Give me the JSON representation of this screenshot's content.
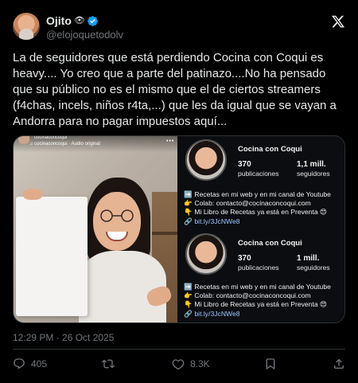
{
  "author": {
    "name": "Ojito",
    "name_emoji": "👁",
    "handle": "@elojoquetodolv",
    "verified": true
  },
  "tweet": {
    "text": "La de seguidores que está perdiendo Cocina con Coqui es heavy.... Yo creo que a parte del patinazo....No ha pensado que su público no es el mismo que el de ciertos streamers (f4chas, incels, niños r4ta,...) que les da igual que se vayan a Andorra para no pagar impuestos aquí...",
    "timestamp": "12:29 PM · 26 Oct 2025"
  },
  "media": {
    "ig_overlay": {
      "handle": "cocinaconcoqui",
      "audio": "♫ cocinaconcoqui · Audio original",
      "more": "•••"
    },
    "profiles": [
      {
        "name": "Cocina con Coqui",
        "posts_count": "370",
        "posts_label": "publicaciones",
        "followers_count": "1,1 mill.",
        "followers_label": "seguidores",
        "bio": [
          {
            "emoji": "➡️",
            "text": "Recetas en mi web y en mi canal de Youtube"
          },
          {
            "emoji": "👉",
            "text": "Colab: contacto@cocinaconcoqui.com"
          },
          {
            "emoji": "👇",
            "text": "Mi Libro de Recetas ya está en Preventa 😍"
          },
          {
            "emoji": "🔗",
            "text": "bit.ly/3JcNWe8"
          }
        ]
      },
      {
        "name": "Cocina con Coqui",
        "posts_count": "370",
        "posts_label": "publicaciones",
        "followers_count": "1 mill.",
        "followers_label": "seguidores",
        "bio": [
          {
            "emoji": "➡️",
            "text": "Recetas en mi web y en mi canal de Youtube"
          },
          {
            "emoji": "👉",
            "text": "Colab: contacto@cocinaconcoqui.com"
          },
          {
            "emoji": "👇",
            "text": "Mi Libro de Recetas ya está en Preventa 😍"
          },
          {
            "emoji": "🔗",
            "text": "bit.ly/3JcNWe8"
          }
        ]
      }
    ]
  },
  "actions": {
    "replies": "405",
    "reposts": "",
    "likes": "8.3K",
    "bookmarks": "",
    "share": ""
  },
  "colors": {
    "background": "#000000",
    "text": "#e7e9ea",
    "muted": "#71767b",
    "verified": "#1d9bf0",
    "link": "#9fc4ff"
  }
}
